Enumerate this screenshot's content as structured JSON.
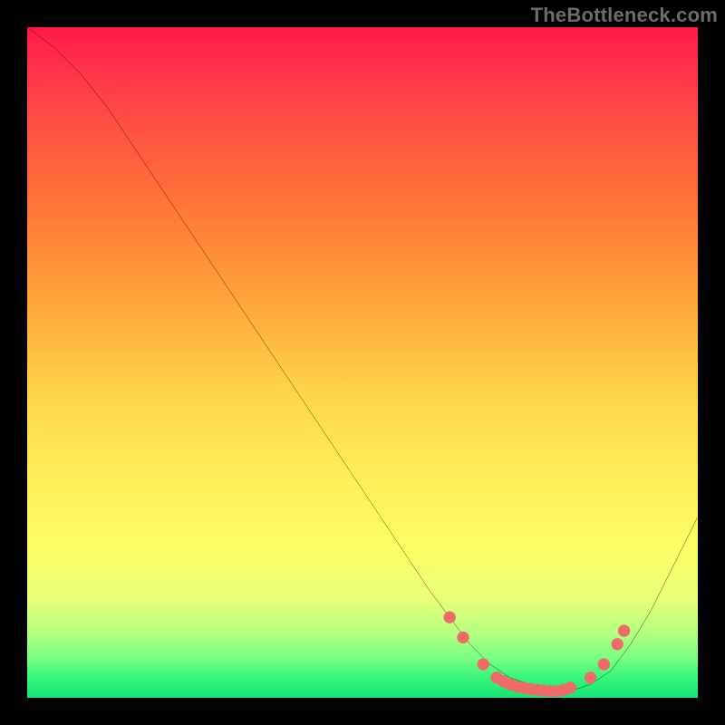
{
  "watermark": "TheBottleneck.com",
  "chart_data": {
    "type": "line",
    "title": "",
    "xlabel": "",
    "ylabel": "",
    "xlim": [
      0,
      100
    ],
    "ylim": [
      0,
      100
    ],
    "series": [
      {
        "name": "curve",
        "x": [
          0,
          4,
          8,
          12,
          16,
          20,
          24,
          28,
          32,
          36,
          40,
          44,
          48,
          52,
          56,
          60,
          63,
          66,
          69,
          72,
          75,
          78,
          81,
          84,
          87,
          90,
          93,
          96,
          100
        ],
        "y": [
          100,
          97,
          93,
          88,
          82,
          76,
          70,
          64,
          58,
          52,
          46,
          40,
          34,
          28,
          22,
          16,
          12,
          8,
          5,
          3,
          2,
          1,
          1,
          2,
          4,
          8,
          13,
          19,
          27
        ]
      }
    ],
    "markers": {
      "name": "highlight-dots",
      "color": "#f06a6a",
      "x": [
        63,
        65,
        68,
        70,
        71,
        72,
        73,
        74,
        75,
        76,
        77,
        78,
        79,
        80,
        81,
        84,
        86,
        88,
        89
      ],
      "y": [
        12,
        9,
        5,
        3,
        2.5,
        2,
        1.7,
        1.5,
        1.3,
        1.2,
        1.1,
        1,
        1,
        1.2,
        1.5,
        3,
        5,
        8,
        10
      ]
    },
    "background": {
      "type": "vertical-gradient",
      "stops": [
        {
          "pos": 0.0,
          "color": "#ff1a4b"
        },
        {
          "pos": 0.25,
          "color": "#ff7038"
        },
        {
          "pos": 0.55,
          "color": "#ffd64a"
        },
        {
          "pos": 0.78,
          "color": "#fbff66"
        },
        {
          "pos": 0.94,
          "color": "#7aff82"
        },
        {
          "pos": 1.0,
          "color": "#15e276"
        }
      ]
    }
  }
}
